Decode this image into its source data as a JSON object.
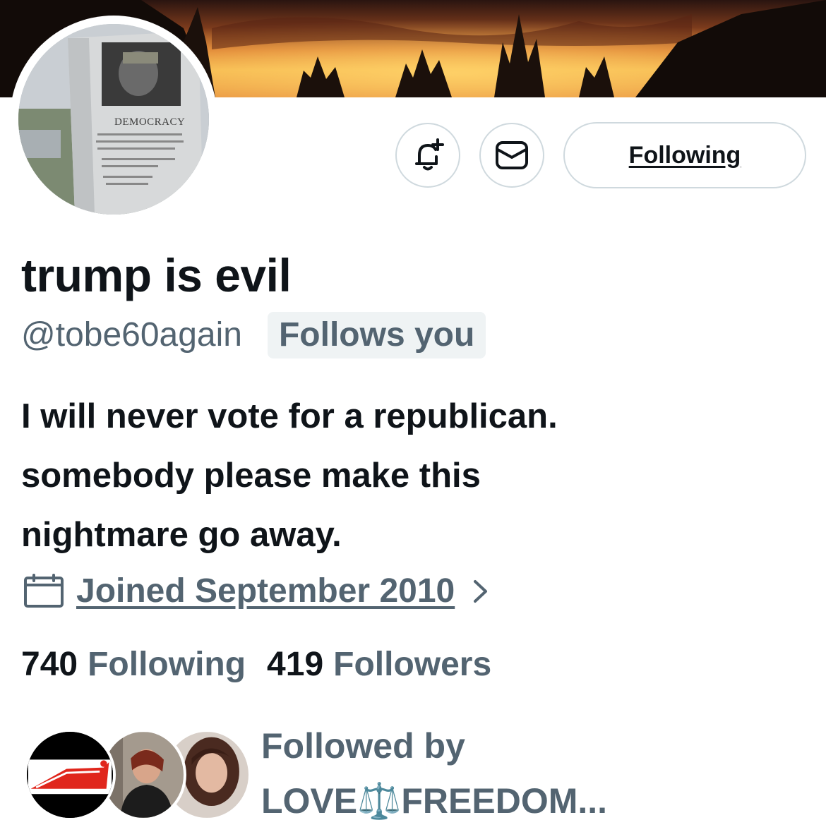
{
  "profile": {
    "display_name": "trump is evil",
    "handle": "@tobe60again",
    "follows_you_badge": "Follows you",
    "bio_lines": [
      "I will never vote for a republican.",
      "somebody please make this",
      "nightmare go away."
    ],
    "joined": "Joined September 2010",
    "avatar_plaque_text": "DEMOCRACY"
  },
  "actions": {
    "notify_icon": "bell-plus-icon",
    "message_icon": "envelope-icon",
    "following_label": "Following"
  },
  "stats": {
    "following_count": "740",
    "following_label": "Following",
    "followers_count": "419",
    "followers_label": "Followers"
  },
  "followed_by": {
    "label": "Followed by",
    "names": "LOVE⚖️FREEDOM..."
  },
  "colors": {
    "text_primary": "#0f1419",
    "text_secondary": "#536471",
    "border": "#cfd9de",
    "badge_bg": "#eff3f4"
  }
}
